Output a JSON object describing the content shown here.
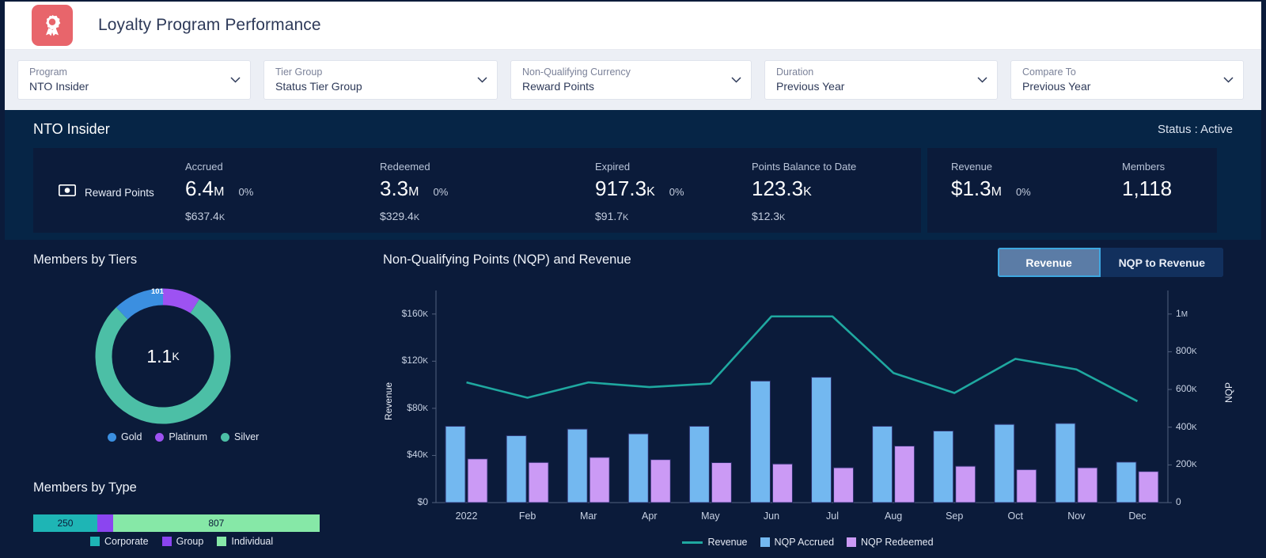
{
  "header": {
    "title": "Loyalty Program Performance",
    "logo_icon": "award-ribbon-icon",
    "logo_color": "#e8656b"
  },
  "filters": [
    {
      "label": "Program",
      "value": "NTO Insider"
    },
    {
      "label": "Tier Group",
      "value": "Status Tier Group"
    },
    {
      "label": "Non-Qualifying Currency",
      "value": "Reward Points"
    },
    {
      "label": "Duration",
      "value": "Previous Year"
    },
    {
      "label": "Compare To",
      "value": "Previous Year"
    }
  ],
  "kpi": {
    "program_name": "NTO Insider",
    "status": "Status : Active",
    "currency_label": "Reward Points",
    "currency_icon": "banknote-icon",
    "cells": [
      {
        "label": "Accrued",
        "value": "6.4",
        "suffix": "M",
        "delta": "0%",
        "sub": "$637.4",
        "sub_suffix": "K"
      },
      {
        "label": "Redeemed",
        "value": "3.3",
        "suffix": "M",
        "delta": "0%",
        "sub": "$329.4",
        "sub_suffix": "K"
      },
      {
        "label": "Expired",
        "value": "917.3",
        "suffix": "K",
        "delta": "0%",
        "sub": "$91.7",
        "sub_suffix": "K"
      },
      {
        "label": "Points Balance to Date",
        "value": "123.3",
        "suffix": "K",
        "delta": "",
        "sub": "$12.3",
        "sub_suffix": "K"
      }
    ],
    "right_cells": [
      {
        "label": "Revenue",
        "value": "$1.3",
        "suffix": "M",
        "delta": "0%"
      },
      {
        "label": "Members",
        "value": "1,118",
        "suffix": "",
        "delta": ""
      }
    ]
  },
  "panels": {
    "members_by_tiers": "Members by Tiers",
    "members_by_type": "Members by Type",
    "nqp_revenue": "Non-Qualifying Points (NQP) and Revenue"
  },
  "toggle": {
    "options": [
      "Revenue",
      "NQP to Revenue"
    ],
    "selected": "Revenue"
  },
  "chart_data": [
    {
      "type": "pie",
      "title": "Members by Tiers",
      "center_label": "1.1",
      "center_suffix": "K",
      "labels": [
        "Gold",
        "Platinum",
        "Silver"
      ],
      "values": [
        136,
        101,
        881
      ],
      "visible_data_labels": [
        "101"
      ],
      "colors": [
        "#3b8fe0",
        "#9d52f2",
        "#4cbfa6"
      ],
      "legend_position": "bottom"
    },
    {
      "type": "bar",
      "title": "Members by Type",
      "orientation": "horizontal-stacked",
      "labels": [
        "Corporate",
        "Group",
        "Individual"
      ],
      "values": [
        250,
        61,
        807
      ],
      "value_labels": [
        "250",
        "",
        "807"
      ],
      "colors": [
        "#1eb5b5",
        "#8b45f0",
        "#86e8a7"
      ],
      "legend_position": "bottom"
    },
    {
      "type": "bar",
      "title": "Non-Qualifying Points (NQP) and Revenue",
      "categories": [
        "2022",
        "Feb",
        "Mar",
        "Apr",
        "May",
        "Jun",
        "Jul",
        "Aug",
        "Sep",
        "Oct",
        "Nov",
        "Dec"
      ],
      "series": [
        {
          "name": "NQP Accrued",
          "type": "bar",
          "axis": "right",
          "color": "#73b8f0",
          "values": [
            405000,
            355000,
            390000,
            365000,
            405000,
            645000,
            665000,
            405000,
            380000,
            415000,
            420000,
            215000
          ]
        },
        {
          "name": "NQP Redeemed",
          "type": "bar",
          "axis": "right",
          "color": "#cb9af5",
          "values": [
            232000,
            213000,
            240000,
            228000,
            212000,
            205000,
            185000,
            300000,
            193000,
            175000,
            185000,
            165000
          ]
        },
        {
          "name": "Revenue",
          "type": "line",
          "axis": "left",
          "color": "#1fa8a0",
          "values": [
            102000,
            89000,
            102000,
            98000,
            101000,
            158000,
            158000,
            110000,
            93000,
            122000,
            113000,
            86000
          ]
        }
      ],
      "ylabel": "Revenue",
      "y2label": "NQP",
      "yticks": [
        "$0",
        "$40",
        "$80",
        "$120",
        "$160"
      ],
      "ytick_suffixes": [
        "",
        "K",
        "K",
        "K",
        "K"
      ],
      "y2ticks": [
        "0",
        "200",
        "400",
        "600",
        "800",
        "1"
      ],
      "y2tick_suffixes": [
        "",
        "K",
        "K",
        "K",
        "K",
        "M"
      ],
      "ylim": [
        0,
        180000
      ],
      "y2lim": [
        0,
        1125000
      ],
      "legend": [
        "Revenue",
        "NQP Accrued",
        "NQP Redeemed"
      ],
      "legend_position": "bottom",
      "grid": false
    }
  ]
}
